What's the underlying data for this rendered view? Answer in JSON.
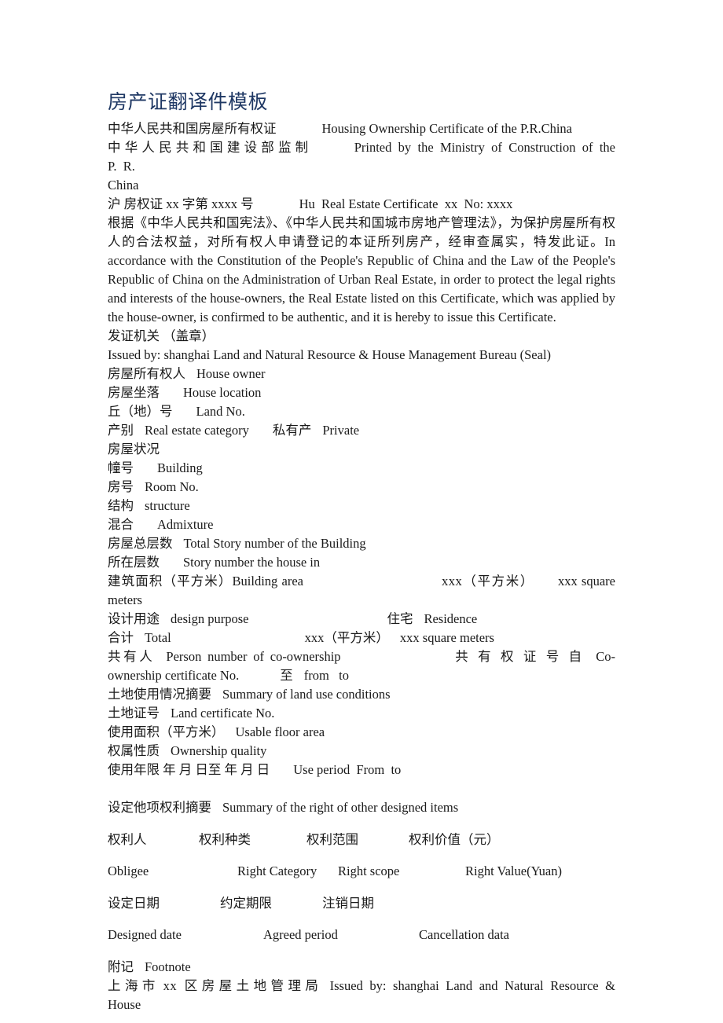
{
  "document": {
    "title": "房产证翻译件模板",
    "title_color": "#1f3864",
    "page_background": "#ffffff",
    "body_color": "#1a1a1a"
  },
  "header_lines": {
    "cert_name_cn": "中华人民共和国房屋所有权证",
    "cert_name_en": "Housing Ownership Certificate of the P.R.China",
    "printed_by_cn": "中 华 人 民 共 和 国 建 设 部 监 制",
    "printed_by_en": "Printed  by  the  Ministry  of  Construction  of  the  P.  R.",
    "printed_by_en_cont": "China",
    "cert_no_cn": "沪 房权证 xx 字第 xxxx 号",
    "cert_no_en": "Hu  Real Estate Certificate  xx  No: xxxx"
  },
  "preamble": {
    "cn": "根据《中华人民共和国宪法》、《中华人民共和国城市房地产管理法》，为保护房屋所有权人的合法权益，对所有权人申请登记的本证所列房产，经审查属实，特发此证。",
    "en": "In accordance with the Constitution of the People's Republic of China and the Law of the People's Republic of China on the Administration of Urban Real Estate, in order to protect the legal rights and interests of the house-owners, the Real Estate listed on this Certificate, which was applied by the house-owner, is confirmed to be authentic, and it is hereby to issue this Certificate."
  },
  "issuer": {
    "label_cn": "发证机关 （盖章）",
    "label_en": "Issued by: shanghai Land and Natural Resource & House Management Bureau (Seal)"
  },
  "fields": [
    {
      "cn": "房屋所有权人",
      "en": "House owner",
      "gap": "sm"
    },
    {
      "cn": "房屋坐落",
      "en": "House location",
      "gap": "md"
    },
    {
      "cn": "丘（地）号",
      "en": "Land No.",
      "gap": "md"
    },
    {
      "cn": "产别",
      "en": "Real estate category",
      "gap": "sm",
      "extra_cn": "私有产",
      "extra_en": "Private"
    },
    {
      "cn": "房屋状况",
      "en": "",
      "gap": "sm"
    },
    {
      "cn": "幢号",
      "en": "Building",
      "gap": "md"
    },
    {
      "cn": "房号",
      "en": "Room No.",
      "gap": "sm"
    },
    {
      "cn": "结构",
      "en": "structure",
      "gap": "sm"
    },
    {
      "cn": "混合",
      "en": "Admixture",
      "gap": "md"
    },
    {
      "cn": "房屋总层数",
      "en": "Total Story number of the Building",
      "gap": "sm"
    },
    {
      "cn": "所在层数",
      "en": "Story number the house in",
      "gap": "md"
    }
  ],
  "area_rows": {
    "building_area_cn": "建筑面积（平方米）",
    "building_area_en": "Building area",
    "building_area_value_cn": "xxx（平方米）",
    "building_area_value_en": "xxx square meters",
    "design_purpose_cn": "设计用途",
    "design_purpose_en": "design purpose",
    "design_purpose_value_cn": "住宅",
    "design_purpose_value_en": "Residence",
    "total_cn": "合计",
    "total_en": "Total",
    "total_value_cn": "xxx（平方米）",
    "total_value_en": "xxx square meters"
  },
  "coownership": {
    "person_cn": "共有人",
    "person_en": "Person number of co-ownership",
    "cert_no_cn": "共 有 权 证 号 自",
    "cert_no_en": "Co-ownership certificate No.",
    "from_cn": "至",
    "from_en": "from   to"
  },
  "land_use": {
    "summary_cn": "土地使用情况摘要",
    "summary_en": "Summary of land use conditions",
    "land_cert_cn": "土地证号",
    "land_cert_en": "Land certificate No.",
    "usable_area_cn": "使用面积（平方米）",
    "usable_area_en": "Usable floor area",
    "ownership_quality_cn": "权属性质",
    "ownership_quality_en": "Ownership quality",
    "use_period_cn": "使用年限 年 月 日至 年 月 日",
    "use_period_en": "Use period  From  to"
  },
  "other_rights": {
    "summary_cn": "设定他项权利摘要",
    "summary_en": "Summary of the right of other designed items",
    "headers_cn": [
      "权利人",
      "权利种类",
      "权利范围",
      "权利价值（元）"
    ],
    "headers_en": [
      "Obligee",
      "Right Category",
      "Right scope",
      "Right Value(Yuan)"
    ],
    "dates_cn": [
      "设定日期",
      "约定期限",
      "注销日期"
    ],
    "dates_en": [
      "Designed date",
      "Agreed period",
      "Cancellation data"
    ]
  },
  "footnote": {
    "label_cn": "附记",
    "label_en": "Footnote"
  },
  "footer": {
    "bureau_cn": "上 海 市  xx  区 房 屋 土 地 管 理 局",
    "bureau_en": "Issued  by:  shanghai  Land  and  Natural  Resource  &  House"
  }
}
